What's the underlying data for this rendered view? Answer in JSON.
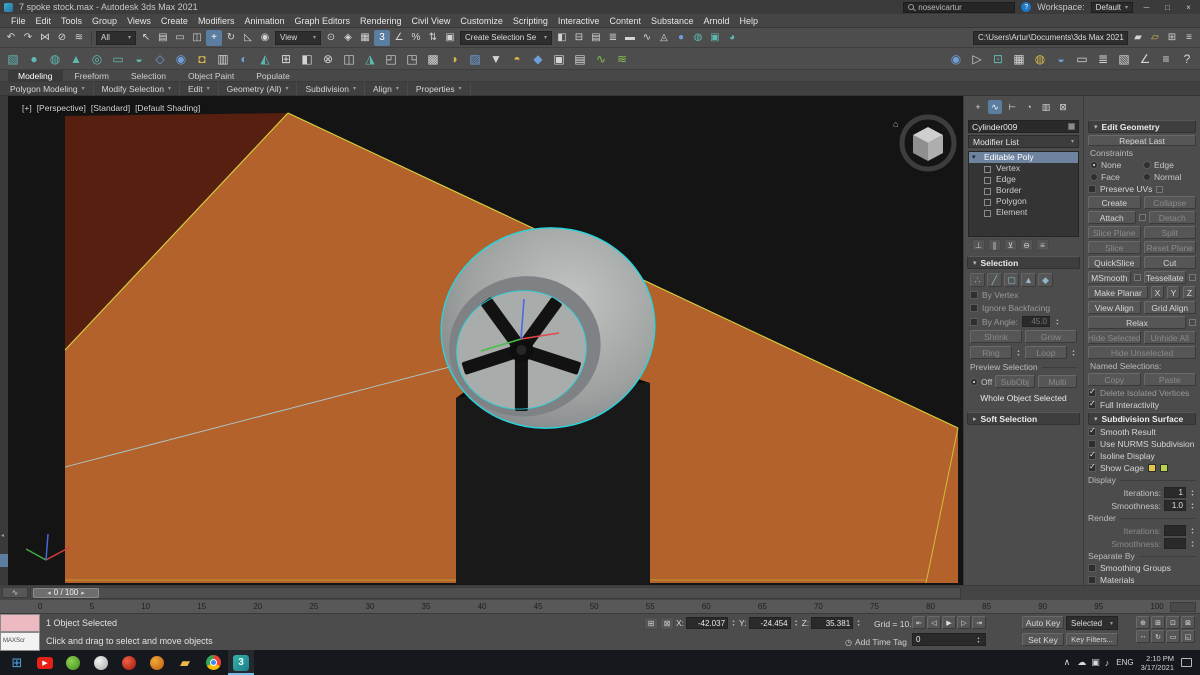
{
  "colors": {
    "panel-bg": "#4c4c4c",
    "accent-blue": "#5a7da0",
    "selection-cyan": "#25d6e0",
    "floor-orange": "#b4622c",
    "wall-maroon": "#571f10",
    "outline-yellow": "#d8d43e",
    "viewport-bg": "#141414",
    "input-bg": "#2a2a2a",
    "stack-sel": "#6e83a0",
    "listener-pink": "#eebac2",
    "listener-white": "#f2f2f2",
    "taskbar-bg": "#15181c"
  },
  "title_bar": {
    "title": "7 spoke stock.max - Autodesk 3ds Max 2021",
    "search_user": "nosevicartur",
    "help_glyph": "?",
    "workspace_label": "Workspace:",
    "workspace_value": "Default",
    "minimize": "─",
    "maximize": "□",
    "close": "×"
  },
  "menu": {
    "items": [
      "File",
      "Edit",
      "Tools",
      "Group",
      "Views",
      "Create",
      "Modifiers",
      "Animation",
      "Graph Editors",
      "Rendering",
      "Civil View",
      "Customize",
      "Scripting",
      "Interactive",
      "Content",
      "Substance",
      "Arnold",
      "Help"
    ]
  },
  "toolbar_main": {
    "icons_a": [
      {
        "n": "undo-icon",
        "g": "↶"
      },
      {
        "n": "redo-icon",
        "g": "↷"
      },
      {
        "n": "select-and-link-icon",
        "g": "⋈"
      },
      {
        "n": "unlink-selection-icon",
        "g": "⊘"
      },
      {
        "n": "bind-to-space-warp-icon",
        "g": "≋"
      }
    ],
    "filter_dropdown": "All",
    "icons_b": [
      {
        "n": "select-object-icon",
        "g": "↖"
      },
      {
        "n": "select-by-name-icon",
        "g": "▤"
      },
      {
        "n": "rectangular-selection-icon",
        "g": "▭"
      },
      {
        "n": "window-crossing-icon",
        "g": "◫"
      },
      {
        "n": "select-and-move-icon",
        "g": "+",
        "cls": "on"
      },
      {
        "n": "select-and-rotate-icon",
        "g": "↻"
      },
      {
        "n": "select-and-scale-icon",
        "g": "◺"
      },
      {
        "n": "select-and-place-icon",
        "g": "◉"
      }
    ],
    "ref_dropdown": "View",
    "icons_c": [
      {
        "n": "use-pivot-center-icon",
        "g": "⊙"
      },
      {
        "n": "select-and-manipulate-icon",
        "g": "◈"
      },
      {
        "n": "keyboard-override-icon",
        "g": "▦"
      },
      {
        "n": "snaps-toggle-icon",
        "g": "3",
        "cls": "on"
      },
      {
        "n": "angle-snap-icon",
        "g": "∠"
      },
      {
        "n": "percent-snap-icon",
        "g": "%"
      },
      {
        "n": "spinner-snap-icon",
        "g": "⇅"
      },
      {
        "n": "edit-named-sets-icon",
        "g": "▣"
      }
    ],
    "sel_set_dropdown": "Create Selection Se",
    "icons_d": [
      {
        "n": "mirror-icon",
        "g": "◧"
      },
      {
        "n": "align-icon",
        "g": "⊟"
      },
      {
        "n": "scene-explorer-icon",
        "g": "▤"
      },
      {
        "n": "layer-explorer-icon",
        "g": "≣"
      },
      {
        "n": "ribbon-toggle-icon",
        "g": "▬"
      },
      {
        "n": "curve-editor-icon",
        "g": "∿"
      },
      {
        "n": "schematic-view-icon",
        "g": "◬"
      },
      {
        "n": "material-editor-icon",
        "g": "●",
        "cls": "c-blue"
      },
      {
        "n": "render-setup-icon",
        "g": "◍",
        "cls": "c-teal"
      },
      {
        "n": "rendered-frame-icon",
        "g": "▣",
        "cls": "c-teal"
      },
      {
        "n": "render-production-icon",
        "g": "◕",
        "cls": "c-teal"
      }
    ],
    "project_path": "C:\\Users\\Artur\\Documents\\3ds Max 2021",
    "icons_e": [
      {
        "n": "asset-tracking-icon",
        "g": "▰"
      },
      {
        "n": "project-folder-icon",
        "g": "▱",
        "cls": "c-yellow"
      },
      {
        "n": "home-grid-icon",
        "g": "⊞"
      },
      {
        "n": "scene-scripts-icon",
        "g": "≡"
      }
    ]
  },
  "toolbar_secondary": {
    "icons": [
      {
        "n": "box-primitive-icon",
        "g": "▧",
        "cls": "c-teal"
      },
      {
        "n": "sphere-primitive-icon",
        "g": "●",
        "cls": "c-teal"
      },
      {
        "n": "cylinder-primitive-icon",
        "g": "◍",
        "cls": "c-teal"
      },
      {
        "n": "cone-primitive-icon",
        "g": "▲",
        "cls": "c-teal"
      },
      {
        "n": "torus-primitive-icon",
        "g": "◎",
        "cls": "c-teal"
      },
      {
        "n": "plane-primitive-icon",
        "g": "▭",
        "cls": "c-teal"
      },
      {
        "n": "teapot-primitive-icon",
        "g": "◒",
        "cls": "c-teal"
      },
      {
        "n": "spline-shapes-icon",
        "g": "◇",
        "cls": "c-blue"
      },
      {
        "n": "camera-icon",
        "g": "◉",
        "cls": "c-blue"
      },
      {
        "n": "light-icon",
        "g": "◘",
        "cls": "c-yellow"
      },
      {
        "n": "helpers-icon",
        "g": "▥"
      },
      {
        "n": "space-warps-icon",
        "g": "◐",
        "cls": "c-blue"
      },
      {
        "n": "systems-icon",
        "g": "◭",
        "cls": "c-teal"
      },
      {
        "n": "array-tool-icon",
        "g": "⊞"
      },
      {
        "n": "mirror-tool-icon",
        "g": "◧"
      },
      {
        "n": "spacing-tool-icon",
        "g": "⊗"
      },
      {
        "n": "clone-align-icon",
        "g": "◫"
      },
      {
        "n": "normal-align-icon",
        "g": "◮",
        "cls": "c-teal"
      },
      {
        "n": "align-camera-icon",
        "g": "◰"
      },
      {
        "n": "place-highlight-icon",
        "g": "◳"
      },
      {
        "n": "isolate-selection-icon",
        "g": "▩"
      },
      {
        "n": "display-floater-icon",
        "g": "◑",
        "cls": "c-yellow"
      },
      {
        "n": "layer-manager-icon",
        "g": "▨",
        "cls": "c-blue"
      },
      {
        "n": "scene-states-icon",
        "g": "▼"
      },
      {
        "n": "light-lister-icon",
        "g": "◓",
        "cls": "c-yellow"
      },
      {
        "n": "material-explorer-icon",
        "g": "◆",
        "cls": "c-blue"
      },
      {
        "n": "property-editor-icon",
        "g": "▣"
      },
      {
        "n": "grab-viewport-icon",
        "g": "▤"
      },
      {
        "n": "motion-capture-icon",
        "g": "∿",
        "cls": "c-green"
      },
      {
        "n": "utilities-extra-icon",
        "g": "≋",
        "cls": "c-green"
      }
    ],
    "icons_right": [
      {
        "n": "mass-fx-icon",
        "g": "◉",
        "cls": "c-blue"
      },
      {
        "n": "simulate-icon",
        "g": "▷"
      },
      {
        "n": "particle-view-icon",
        "g": "⊡",
        "cls": "c-teal"
      },
      {
        "n": "state-sets-icon",
        "g": "▦"
      },
      {
        "n": "render-effects-icon",
        "g": "◍",
        "cls": "c-yellow"
      },
      {
        "n": "environment-icon",
        "g": "◒",
        "cls": "c-blue"
      },
      {
        "n": "video-post-icon",
        "g": "▭"
      },
      {
        "n": "batch-render-icon",
        "g": "≣"
      },
      {
        "n": "asset-browser-icon",
        "g": "▧"
      },
      {
        "n": "measure-icon",
        "g": "∠"
      },
      {
        "n": "script-listener-icon",
        "g": "≡"
      },
      {
        "n": "help-tool-icon",
        "g": "?"
      }
    ]
  },
  "ribbon": {
    "tabs": [
      {
        "label": "Modeling",
        "cls": "on"
      },
      {
        "label": "Freeform"
      },
      {
        "label": "Selection"
      },
      {
        "label": "Object Paint"
      },
      {
        "label": "Populate"
      }
    ],
    "panels": [
      "Polygon Modeling",
      "Modify Selection",
      "Edit",
      "Geometry (All)",
      "Subdivision",
      "Align",
      "Properties"
    ]
  },
  "viewport": {
    "tag_plus": "[+]",
    "tag_view": "[Perspective]",
    "tag_renderer": "[Standard]",
    "tag_shading": "[Default Shading]"
  },
  "command_panel": {
    "tabs": [
      {
        "n": "create-tab-icon",
        "g": "+"
      },
      {
        "n": "modify-tab-icon",
        "g": "∿",
        "cls": "on"
      },
      {
        "n": "hierarchy-tab-icon",
        "g": "⊢"
      },
      {
        "n": "motion-tab-icon",
        "g": "◔"
      },
      {
        "n": "display-tab-icon",
        "g": "▥"
      },
      {
        "n": "utilities-tab-icon",
        "g": "⊠"
      }
    ],
    "object_name": "Cylinder009",
    "modifier_list_label": "Modifier List",
    "stack": [
      {
        "label": "Editable Poly",
        "cls": "sel"
      },
      {
        "label": "Vertex",
        "cls": "sub"
      },
      {
        "label": "Edge",
        "cls": "sub"
      },
      {
        "label": "Border",
        "cls": "sub"
      },
      {
        "label": "Polygon",
        "cls": "sub"
      },
      {
        "label": "Element",
        "cls": "sub"
      }
    ],
    "stack_tools": [
      {
        "n": "pin-stack-icon",
        "g": "⊥"
      },
      {
        "n": "show-end-result-icon",
        "g": "∥"
      },
      {
        "n": "make-unique-icon",
        "g": "⊻"
      },
      {
        "n": "remove-modifier-icon",
        "g": "⊖"
      },
      {
        "n": "configure-modifier-sets-icon",
        "g": "≡"
      }
    ],
    "selection": {
      "title": "Selection",
      "modes": [
        {
          "n": "vertex-mode-icon",
          "g": "∴"
        },
        {
          "n": "edge-mode-icon",
          "g": "╱"
        },
        {
          "n": "border-mode-icon",
          "g": "▢"
        },
        {
          "n": "polygon-mode-icon",
          "g": "▲"
        },
        {
          "n": "element-mode-icon",
          "g": "◆"
        }
      ],
      "by_vertex": "By Vertex",
      "ignore_backfacing": "Ignore Backfacing",
      "by_angle": "By Angle:",
      "angle_value": "45.0",
      "shrink": "Shrink",
      "grow": "Grow",
      "ring": "Ring",
      "loop": "Loop",
      "preview_label": "Preview Selection",
      "preview_off": "Off",
      "preview_subobj": "SubObj",
      "preview_multi": "Multi",
      "status": "Whole Object Selected"
    },
    "soft_selection_title": "Soft Selection"
  },
  "edit_geometry": {
    "title": "Edit Geometry",
    "repeat_last": "Repeat Last",
    "constraints_label": "Constraints",
    "constraints": [
      {
        "label": "None",
        "cls": "checked"
      },
      {
        "label": "Edge"
      },
      {
        "label": "Face"
      },
      {
        "label": "Normal"
      }
    ],
    "preserve_uvs": "Preserve UVs",
    "create": "Create",
    "collapse": "Collapse",
    "attach": "Attach",
    "detach": "Detach",
    "slice_plane": "Slice Plane",
    "split": "Split",
    "slice": "Slice",
    "reset_plane": "Reset Plane",
    "quickslice": "QuickSlice",
    "cut": "Cut",
    "msmooth": "MSmooth",
    "tessellate": "Tessellate",
    "make_planar": "Make Planar",
    "x": "X",
    "y": "Y",
    "z": "Z",
    "view_align": "View Align",
    "grid_align": "Grid Align",
    "relax": "Relax",
    "hide_selected": "Hide Selected",
    "unhide_all": "Unhide All",
    "hide_unselected": "Hide Unselected",
    "named_selections": "Named Selections:",
    "copy": "Copy",
    "paste": "Paste",
    "delete_isolated": "Delete Isolated Vertices",
    "full_interactivity": "Full Interactivity"
  },
  "subdivision_surface": {
    "title": "Subdivision Surface",
    "smooth_result": "Smooth Result",
    "use_nurms": "Use NURMS Subdivision",
    "isoline_display": "Isoline Display",
    "show_cage": "Show Cage",
    "display_label": "Display",
    "iterations_label": "Iterations:",
    "iterations_value": "1",
    "smoothness_label": "Smoothness:",
    "smoothness_value": "1.0",
    "render_label": "Render",
    "render_iterations_label": "Iterations:",
    "render_smoothness_label": "Smoothness:",
    "separate_by_label": "Separate By",
    "smoothing_groups": "Smoothing Groups",
    "materials": "Materials"
  },
  "timeline": {
    "slider_label": "0 / 100",
    "ticks": [
      "0",
      "5",
      "10",
      "15",
      "20",
      "25",
      "30",
      "35",
      "40",
      "45",
      "50",
      "55",
      "60",
      "65",
      "70",
      "75",
      "80",
      "85",
      "90",
      "95",
      "100"
    ]
  },
  "status_bar": {
    "listener_label": "MAXScr",
    "selected_text": "1 Object Selected",
    "prompt": "Click and drag to select and move objects",
    "mode_icons": [
      {
        "n": "absolute-mode-icon",
        "g": "⊞"
      },
      {
        "n": "selection-lock-icon",
        "g": "⊠"
      }
    ],
    "x_label": "X:",
    "x_value": "-42.037",
    "y_label": "Y:",
    "y_value": "-24.454",
    "z_label": "Z:",
    "z_value": "35.381",
    "grid_text": "Grid = 10.0",
    "add_time_tag": "Add Time Tag",
    "frame_value": "0",
    "playback": [
      {
        "n": "go-to-start-icon",
        "g": "⇤"
      },
      {
        "n": "previous-frame-icon",
        "g": "◁"
      },
      {
        "n": "play-icon",
        "g": "▶"
      },
      {
        "n": "next-frame-icon",
        "g": "▷"
      },
      {
        "n": "go-to-end-icon",
        "g": "⇥"
      }
    ],
    "auto_key": "Auto Key",
    "set_key": "Set Key",
    "key_filter_dropdown": "Selected",
    "key_filters": "Key Filters...",
    "nav": [
      {
        "n": "zoom-icon",
        "g": "⊕"
      },
      {
        "n": "zoom-all-icon",
        "g": "⊞"
      },
      {
        "n": "zoom-extents-icon",
        "g": "⊡"
      },
      {
        "n": "zoom-extents-all-icon",
        "g": "⊠"
      },
      {
        "n": "pan-icon",
        "g": "↔"
      },
      {
        "n": "orbit-icon",
        "g": "↻"
      },
      {
        "n": "zoom-region-icon",
        "g": "▭"
      },
      {
        "n": "maximize-viewport-icon",
        "g": "◱"
      }
    ]
  },
  "taskbar": {
    "apps": [
      {
        "n": "start-icon",
        "g": "⊞",
        "cls": "start"
      },
      {
        "n": "youtube-icon",
        "g": "▶",
        "cls": "yt"
      },
      {
        "n": "browser-green-icon",
        "g": "",
        "cls": "ball-green"
      },
      {
        "n": "app-light-icon",
        "g": "",
        "cls": "ball-light"
      },
      {
        "n": "app-red-icon",
        "g": "",
        "cls": "ball-red"
      },
      {
        "n": "app-orange-icon",
        "g": "",
        "cls": "ball-orange"
      },
      {
        "n": "folder-icon",
        "g": "▰",
        "cls": "fold"
      },
      {
        "n": "chrome-icon",
        "g": "",
        "cls": "chrome"
      },
      {
        "n": "3dsmax-icon",
        "g": "3",
        "cls": "max on"
      }
    ],
    "tray_expand": "∧",
    "tray_icons": [
      {
        "n": "cloud-icon",
        "g": "☁"
      },
      {
        "n": "security-icon",
        "g": "▣"
      },
      {
        "n": "volume-icon",
        "g": "♪"
      }
    ],
    "language": "ENG",
    "time": "2:10 PM",
    "date": "3/17/2021"
  }
}
